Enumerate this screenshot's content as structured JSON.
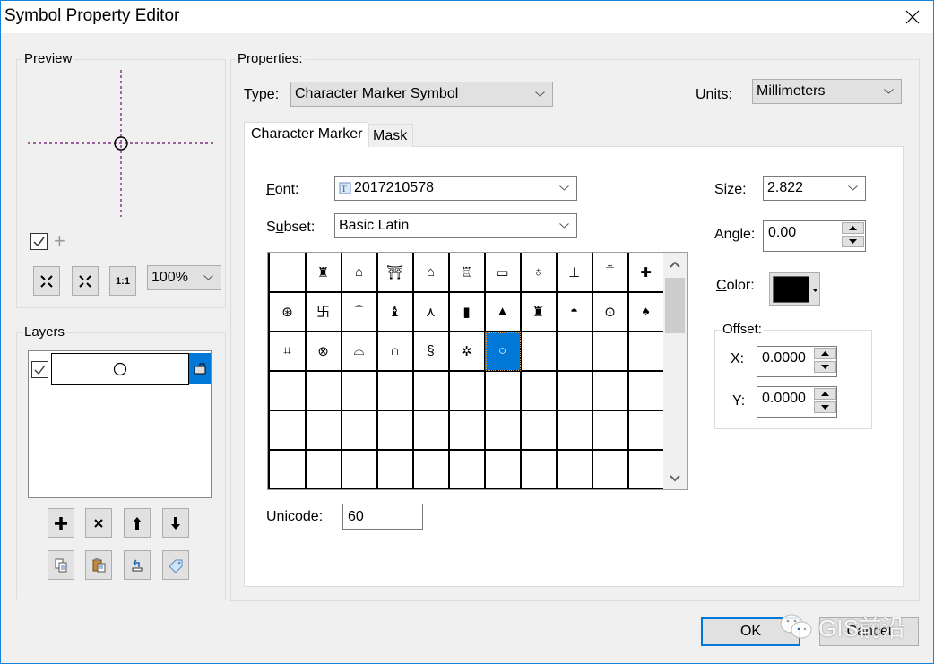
{
  "window": {
    "title": "Symbol Property Editor"
  },
  "preview": {
    "label": "Preview",
    "zoom_value": "100%",
    "checkbox_checked": true,
    "buttons": [
      "zoom-in-icon",
      "zoom-out-icon",
      "actual-size-icon"
    ],
    "actual_size_label": "1:1"
  },
  "layers": {
    "label": "Layers",
    "items": [
      {
        "checked": true,
        "symbol": "○",
        "locked": false
      }
    ],
    "buttons_row1": [
      "add-layer",
      "delete-layer",
      "move-up",
      "move-down"
    ],
    "buttons_row2": [
      "copy-layer",
      "paste-layer",
      "reset",
      "tag"
    ]
  },
  "properties": {
    "label": "Properties:",
    "type_label": "Type:",
    "type_value": "Character Marker Symbol",
    "units_label": "Units:",
    "units_value": "Millimeters",
    "tabs": [
      {
        "label": "Character Marker",
        "active": true
      },
      {
        "label": "Mask",
        "active": false
      }
    ],
    "font_label_u": "F",
    "font_label_rest": "ont:",
    "font_value": "2017210578",
    "subset_label_pre": "S",
    "subset_label_u": "u",
    "subset_label_rest": "bset:",
    "subset_value": "Basic Latin",
    "glyphs": [
      "",
      "♜",
      "⌂",
      "⛩",
      "⌂",
      "♖",
      "▭",
      "♁",
      "⊥",
      "⍡",
      "✚",
      "⊛",
      "卐",
      "⍑",
      "♝",
      "⋏",
      "▮",
      "▲",
      "♜",
      "◓",
      "⊙",
      "♠",
      "⌗",
      "⊗",
      "⌓",
      "∩",
      "§",
      "✲",
      "○",
      "",
      "",
      "",
      "",
      "",
      "",
      "",
      "",
      "",
      "",
      "",
      "",
      "",
      "",
      "",
      "",
      "",
      "",
      "",
      "",
      "",
      "",
      "",
      "",
      "",
      "",
      "",
      "",
      "",
      "",
      "",
      "",
      "",
      "",
      "",
      "",
      ""
    ],
    "selected_index": 28,
    "unicode_label": "Unicode:",
    "unicode_value": "60",
    "size_label": "Size:",
    "size_value": "2.822",
    "angle_label": "Angle:",
    "angle_value": "0.00",
    "color_label_u": "C",
    "color_label_rest": "olor:",
    "color_value": "#000000",
    "offset_label": "Offset:",
    "x_label": "X:",
    "x_value": "0.0000",
    "y_label": "Y:",
    "y_value": "0.0000"
  },
  "footer": {
    "ok_label": "OK",
    "cancel_label": "Cancel",
    "watermark": "GIS前沿"
  }
}
